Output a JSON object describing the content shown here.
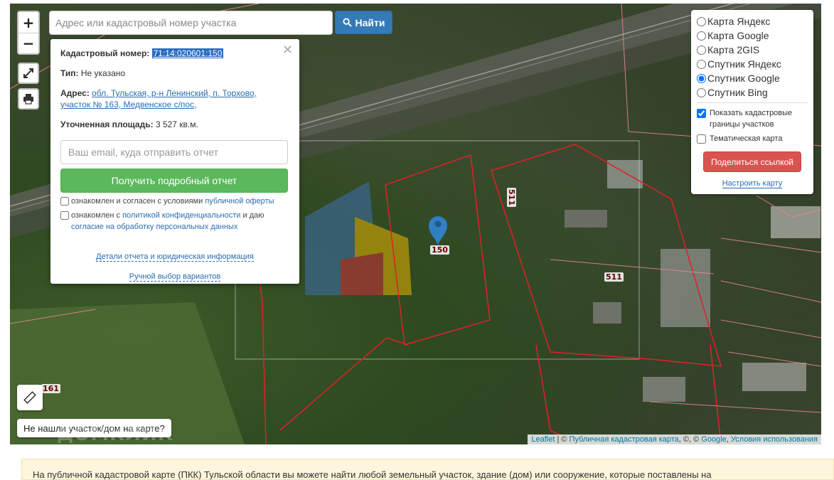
{
  "search": {
    "placeholder": "Адрес или кадастровый номер участка",
    "button_label": "Найти"
  },
  "zoom": {
    "in_label": "+",
    "out_label": "−"
  },
  "popup": {
    "cad_label": "Кадастровый номер:",
    "cad_value": "71:14:020601:150",
    "type_label": "Тип:",
    "type_value": "Не указано",
    "address_label": "Адрес:",
    "address_line1": "обл. Тульская, р-н Ленинский, п. Торхово,",
    "address_line2": "участок № 163, Медвенское с/пос,",
    "area_label": "Уточненная площадь:",
    "area_value": "3 527 кв.м.",
    "email_placeholder": "Ваш email, куда отправить отчет",
    "report_button": "Получить подробный отчет",
    "agree1_text": "ознакомлен и согласен с условиями",
    "agree1_link": "публичной оферты",
    "agree2_text_a": "ознакомлен с",
    "agree2_link_a": "политикой конфиденциальности",
    "agree2_text_b": "и даю",
    "agree2_link_b": "согласие на обработку персональных данных",
    "details_link": "Детали отчета и юридическая информация",
    "manual_link": "Ручной выбор вариантов"
  },
  "layers": {
    "options": [
      {
        "label": "Карта Яндекс",
        "checked": false
      },
      {
        "label": "Карта Google",
        "checked": false
      },
      {
        "label": "Карта 2GIS",
        "checked": false
      },
      {
        "label": "Спутник Яндекс",
        "checked": false
      },
      {
        "label": "Спутник Google",
        "checked": true
      },
      {
        "label": "Спутник Bing",
        "checked": false
      }
    ],
    "show_borders_label": "Показать кадастровые границы участков",
    "show_borders_checked": true,
    "thematic_label": "Тематическая карта",
    "thematic_checked": false,
    "share_button": "Поделиться ссылкой",
    "tune_link": "Настроить карту"
  },
  "map": {
    "parcel_labels": [
      "511",
      "511",
      "150",
      "161"
    ],
    "not_found_button": "Не нашли участок/дом на карте?",
    "attribution_leaflet": "Leaflet",
    "attribution_pkk": "Публичная кадастровая карта",
    "attribution_google": "Google",
    "attribution_terms": "Условия использования",
    "watermark": "ДОМКЛИК"
  },
  "banner": {
    "text": "На публичной кадастровой карте (ПКК) Тульской области вы можете найти любой земельный участок, здание (дом) или сооружение, которые поставлены на"
  },
  "colors": {
    "primary": "#337ab7",
    "success": "#5cb85c",
    "danger": "#d9534f",
    "parcel_border": "#e0202a"
  }
}
